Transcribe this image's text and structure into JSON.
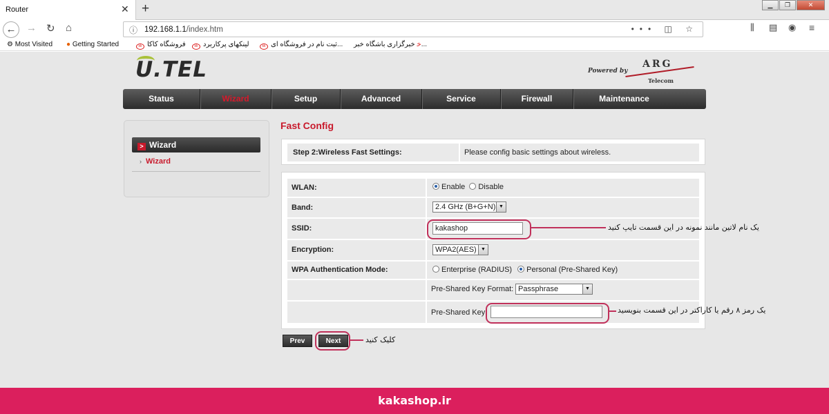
{
  "browser": {
    "tab_title": "Router",
    "url_host": "192.168.1.1",
    "url_path": "/index.htm",
    "bookmarks": [
      {
        "label": "Most Visited",
        "icon": "gear-icon"
      },
      {
        "label": "Getting Started",
        "icon": "firefox-icon"
      },
      {
        "label": "فروشگاه کاکا",
        "icon": "kaka-icon"
      },
      {
        "label": "لینکهای پرکاربرد",
        "icon": "kaka-icon"
      },
      {
        "label": "ثبت نام در فروشگاه ای...",
        "icon": "kaka-icon"
      },
      {
        "label": "خبرگزاری باشگاه خبر...",
        "icon": "news-icon"
      }
    ]
  },
  "router": {
    "logo": "U.TEL",
    "powered_by": "Powered by",
    "brand": "ARG",
    "brand_sub": "Telecom",
    "menu": [
      "Status",
      "Wizard",
      "Setup",
      "Advanced",
      "Service",
      "Firewall",
      "Maintenance"
    ],
    "active_menu": "Wizard",
    "sidebar": {
      "heading": "Wizard",
      "link": "Wizard"
    },
    "title": "Fast Config",
    "step_label": "Step 2:Wireless Fast Settings:",
    "step_desc": "Please config basic settings about wireless.",
    "form": {
      "wlan_label": "WLAN:",
      "wlan_enable": "Enable",
      "wlan_disable": "Disable",
      "wlan_value": "Enable",
      "band_label": "Band:",
      "band_value": "2.4 GHz (B+G+N)",
      "ssid_label": "SSID:",
      "ssid_value": "kakashop",
      "encryption_label": "Encryption:",
      "encryption_value": "WPA2(AES)",
      "auth_label": "WPA Authentication Mode:",
      "auth_enterprise": "Enterprise (RADIUS)",
      "auth_personal": "Personal (Pre-Shared Key)",
      "auth_value": "Personal (Pre-Shared Key)",
      "psk_format_label": "Pre-Shared Key Format:",
      "psk_format_value": "Passphrase",
      "psk_label": "Pre-Shared Key:",
      "psk_value": ""
    },
    "prev_button": "Prev",
    "next_button": "Next"
  },
  "annotations": {
    "ssid_note": "یک نام لاتین مانند نمونه در این قسمت تایپ کنید",
    "psk_note": "یک رمز ۸ رقم یا کاراکتر در این قسمت بنویسید",
    "next_note": "کلیک کنید",
    "highlight_color": "#c0305a"
  },
  "footer": "kakashop.ir",
  "colors": {
    "accent_red": "#c8192b",
    "footer_bg": "#db1f5d"
  }
}
